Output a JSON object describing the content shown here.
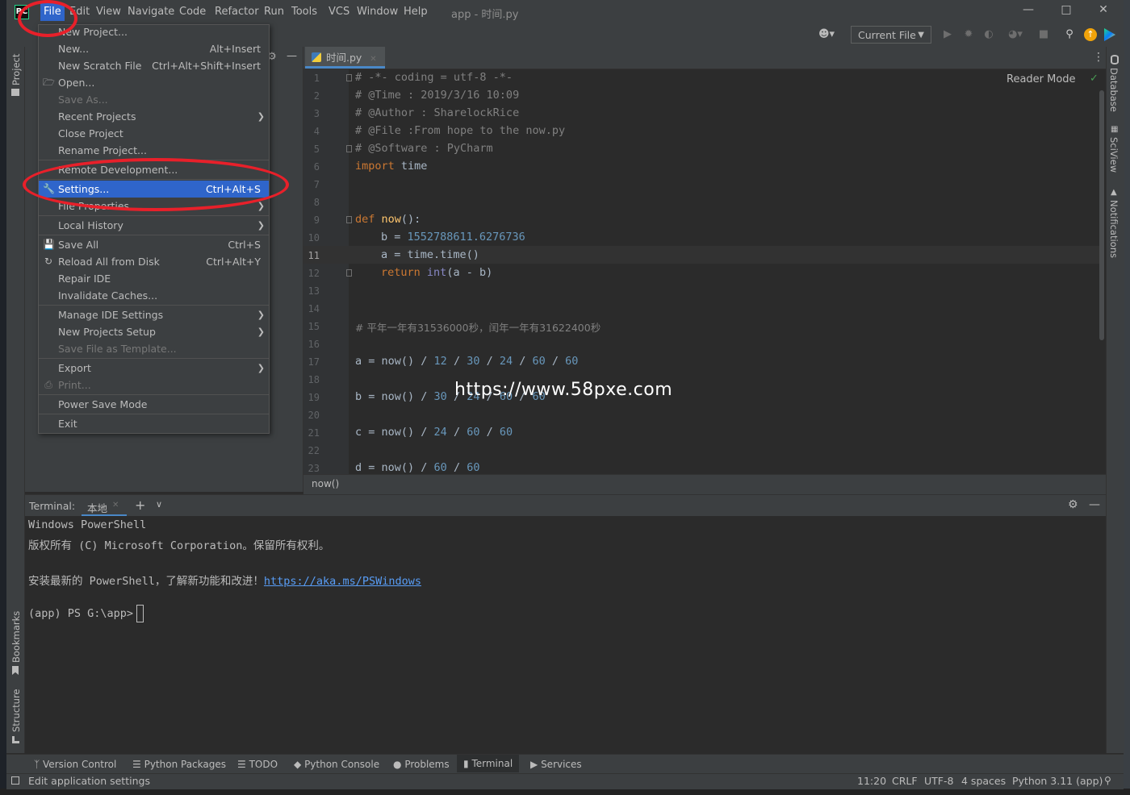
{
  "menubar": {
    "items": [
      "File",
      "Edit",
      "View",
      "Navigate",
      "Code",
      "Refactor",
      "Run",
      "Tools",
      "VCS",
      "Window",
      "Help"
    ],
    "title": "app - 时间.py"
  },
  "toolbar": {
    "run_config": "Current File"
  },
  "left_strip": {
    "project": "Project",
    "bookmarks": "Bookmarks",
    "structure": "Structure"
  },
  "right_strip": {
    "database": "Database",
    "sciview": "SciView",
    "notifications": "Notifications"
  },
  "editor": {
    "tab": "时间.py",
    "reader_mode": "Reader Mode",
    "breadcrumb": "now()",
    "current_line": 11,
    "line_numbers": [
      "1",
      "2",
      "3",
      "4",
      "5",
      "6",
      "7",
      "8",
      "9",
      "10",
      "11",
      "12",
      "13",
      "14",
      "15",
      "16",
      "17",
      "18",
      "19",
      "20",
      "21",
      "22",
      "23"
    ],
    "lines": {
      "l1": "# -*- coding = utf-8 -*-",
      "l2": "# @Time : 2019/3/16 10:09",
      "l3": "# @Author : SharelockRice",
      "l4": "# @File :From hope to the now.py",
      "l5": "# @Software : PyCharm",
      "l6_kw": "import",
      "l6_rest": " time",
      "l9_kw": "def",
      "l9_fn": "now",
      "l9_rest": "():",
      "l10_a": "b = ",
      "l10_num": "1552788611.6276736",
      "l11": "a = time.time()",
      "l12_kw": "return",
      "l12_bi": "int",
      "l12_rest": "(a - b)",
      "l15": "# 平年一年有31536000秒，闰年一年有31622400秒",
      "l17_a": "a = now() / ",
      "l17_n1": "12",
      "l17_n2": "30",
      "l17_n3": "24",
      "l17_n4": "60",
      "l17_n5": "60",
      "l19_a": "b = now() / ",
      "l19_n1": "30",
      "l19_n2": "24",
      "l19_n3": "60",
      "l19_n4": "60",
      "l21_a": "c = now() / ",
      "l21_n1": "24",
      "l21_n2": "60",
      "l21_n3": "60",
      "l23_a": "d = now() / ",
      "l23_n1": "60",
      "l23_n2": "60",
      "div": " / "
    }
  },
  "terminal": {
    "label": "Terminal:",
    "tab": "本地",
    "line1": "Windows PowerShell",
    "line2": "版权所有 (C) Microsoft Corporation。保留所有权利。",
    "line3_text": "安装最新的 PowerShell，了解新功能和改进！",
    "line3_link": "https://aka.ms/PSWindows",
    "prompt": "(app) PS G:\\app> "
  },
  "file_menu": {
    "items": [
      {
        "label": "New Project...",
        "shortcut": ""
      },
      {
        "label": "New...",
        "shortcut": "Alt+Insert"
      },
      {
        "label": "New Scratch File",
        "shortcut": "Ctrl+Alt+Shift+Insert"
      },
      {
        "label": "Open...",
        "shortcut": ""
      },
      {
        "label": "Save As...",
        "shortcut": ""
      },
      {
        "label": "Recent Projects",
        "shortcut": ""
      },
      {
        "label": "Close Project",
        "shortcut": ""
      },
      {
        "label": "Rename Project...",
        "shortcut": ""
      },
      {
        "label": "Remote Development...",
        "shortcut": ""
      },
      {
        "label": "Settings...",
        "shortcut": "Ctrl+Alt+S"
      },
      {
        "label": "File Properties",
        "shortcut": ""
      },
      {
        "label": "Local History",
        "shortcut": ""
      },
      {
        "label": "Save All",
        "shortcut": "Ctrl+S"
      },
      {
        "label": "Reload All from Disk",
        "shortcut": "Ctrl+Alt+Y"
      },
      {
        "label": "Repair IDE",
        "shortcut": ""
      },
      {
        "label": "Invalidate Caches...",
        "shortcut": ""
      },
      {
        "label": "Manage IDE Settings",
        "shortcut": ""
      },
      {
        "label": "New Projects Setup",
        "shortcut": ""
      },
      {
        "label": "Save File as Template...",
        "shortcut": ""
      },
      {
        "label": "Export",
        "shortcut": ""
      },
      {
        "label": "Print...",
        "shortcut": ""
      },
      {
        "label": "Power Save Mode",
        "shortcut": ""
      },
      {
        "label": "Exit",
        "shortcut": ""
      }
    ]
  },
  "bottom_tabs": {
    "version_control": "Version Control",
    "python_packages": "Python Packages",
    "todo": "TODO",
    "python_console": "Python Console",
    "problems": "Problems",
    "terminal": "Terminal",
    "services": "Services"
  },
  "status": {
    "message": "Edit application settings",
    "position": "11:20",
    "line_sep": "CRLF",
    "encoding": "UTF-8",
    "indent": "4 spaces",
    "interpreter": "Python 3.11 (app)"
  },
  "watermark": "https://www.58pxe.com"
}
